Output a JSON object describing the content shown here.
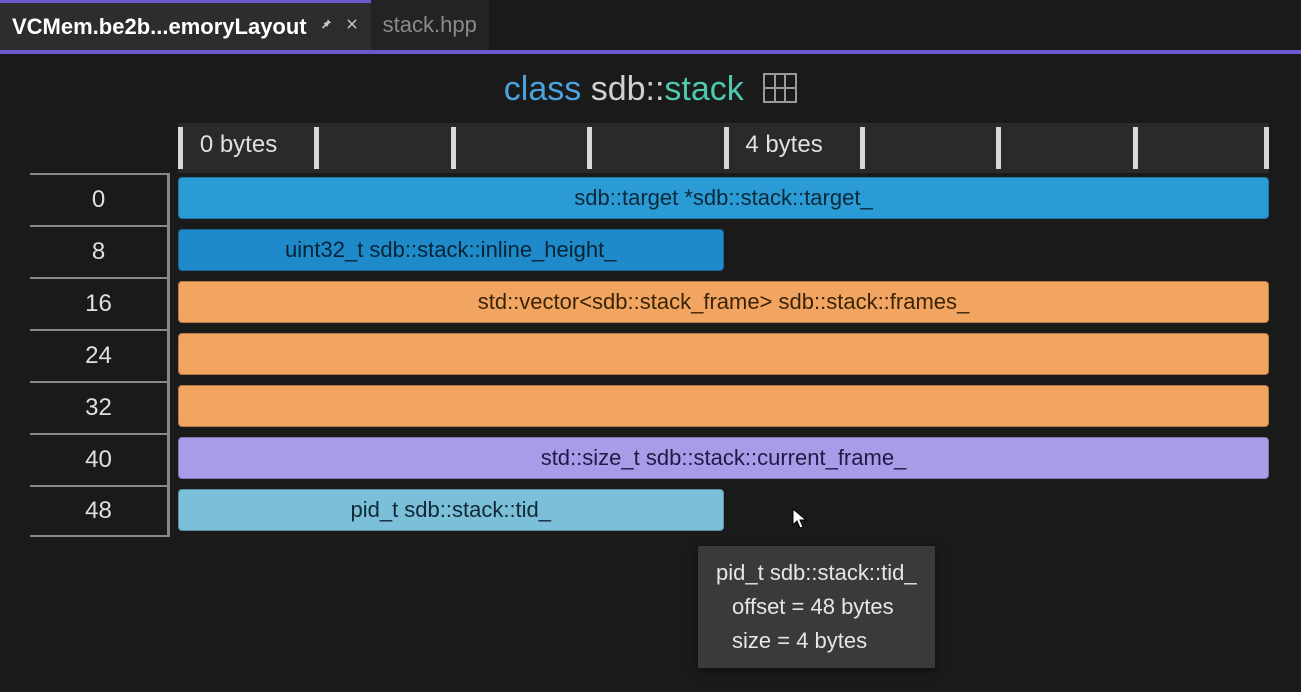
{
  "tabs": {
    "active": "VCMem.be2b...emoryLayout",
    "inactive": "stack.hpp"
  },
  "title": {
    "keyword": "class",
    "namespace": "sdb::",
    "classname": "stack"
  },
  "ruler": {
    "label0": "0 bytes",
    "label4": "4 bytes"
  },
  "offsets": [
    "0",
    "8",
    "16",
    "24",
    "32",
    "40",
    "48"
  ],
  "fields": {
    "target": "sdb::target *sdb::stack::target_",
    "inline_height": "uint32_t sdb::stack::inline_height_",
    "frames": "std::vector<sdb::stack_frame> sdb::stack::frames_",
    "current_frame": "std::size_t sdb::stack::current_frame_",
    "tid": "pid_t sdb::stack::tid_"
  },
  "tooltip": {
    "line1": "pid_t sdb::stack::tid_",
    "line2": "offset = 48 bytes",
    "line3": "size = 4 bytes"
  },
  "chart_data": {
    "type": "table",
    "title": "class sdb::stack memory layout",
    "row_stride_bytes": 8,
    "columns_bytes": 8,
    "members": [
      {
        "name": "target_",
        "type": "sdb::target *",
        "offset": 0,
        "size": 8,
        "color": "#2b9bd6"
      },
      {
        "name": "inline_height_",
        "type": "uint32_t",
        "offset": 8,
        "size": 4,
        "color": "#1f8ac9"
      },
      {
        "name": "frames_",
        "type": "std::vector<sdb::stack_frame>",
        "offset": 16,
        "size": 24,
        "color": "#f2a561"
      },
      {
        "name": "current_frame_",
        "type": "std::size_t",
        "offset": 40,
        "size": 8,
        "color": "#a99be8"
      },
      {
        "name": "tid_",
        "type": "pid_t",
        "offset": 48,
        "size": 4,
        "color": "#7bbfd9"
      }
    ]
  }
}
